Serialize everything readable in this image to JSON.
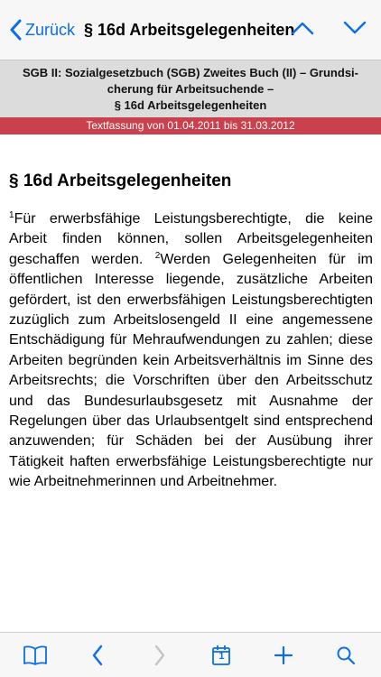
{
  "navbar": {
    "back_label": "Zurück",
    "title": "§ 16d Arbeitsgelegenheiten"
  },
  "header": {
    "line1": "SGB II: Sozialgesetzbuch (SGB) Zweites Buch (II) – Grundsi-",
    "line2": "cherung für Arbeitsuchende –",
    "line3": "§ 16d Arbeitsgelegenheiten"
  },
  "version": {
    "text": "Textfassung von 01.04.2011 bis 31.03.2012"
  },
  "content": {
    "heading": "§ 16d Arbeitsgelegenheiten",
    "sentence1_marker": "1",
    "sentence1": "Für erwerbsfähige Leistungsberechtigte, die keine Arbeit finden können, sollen Arbeitsgelegenheiten geschaffen werden. ",
    "sentence2_marker": "2",
    "sentence2": "Werden Gelegenheiten für im öffentlichen Interesse liegende, zusätzliche Arbeiten gefördert, ist den erwerbsfähigen Leistungsberechtigten zuzüglich zum Arbeitslosengeld II eine angemessene Entschädigung für Mehraufwendungen zu zahlen; diese Arbeiten begründen kein Arbeitsverhältnis im Sinne des Arbeitsrechts; die Vorschriften über den Arbeitsschutz und das Bundesurlaubsgesetz mit Ausnahme der Regelungen über das Urlaubsentgelt sind entsprechend anzuwenden; für Schäden bei der Ausübung ihrer Tätigkeit haften erwerbsfähige Leistungsberechtigte nur wie Arbeitnehmerinnen und Arbeitnehmer."
  },
  "tabbar": {
    "calendar_day": "1",
    "icons": [
      "book-icon",
      "chevron-left-icon",
      "chevron-right-icon",
      "calendar-icon",
      "plus-icon",
      "search-icon"
    ]
  },
  "colors": {
    "accent": "#0a6ee8",
    "version_bar": "#c8414d",
    "header_band": "#dcdcdd",
    "disabled": "#c4c4c6"
  }
}
